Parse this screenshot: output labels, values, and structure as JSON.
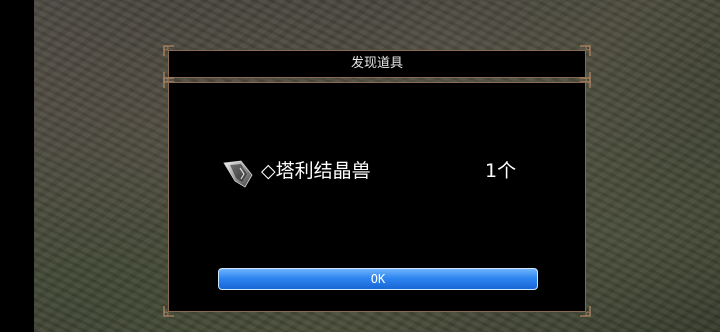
{
  "dialog": {
    "title": "发现道具",
    "item": {
      "icon": "crystal-shard-icon",
      "name": "◇塔利结晶兽",
      "count": "1个"
    },
    "ok_label": "OK"
  },
  "colors": {
    "frame": "#8a6a4e",
    "button_top": "#6fb4ff",
    "button_bottom": "#1766d6"
  }
}
